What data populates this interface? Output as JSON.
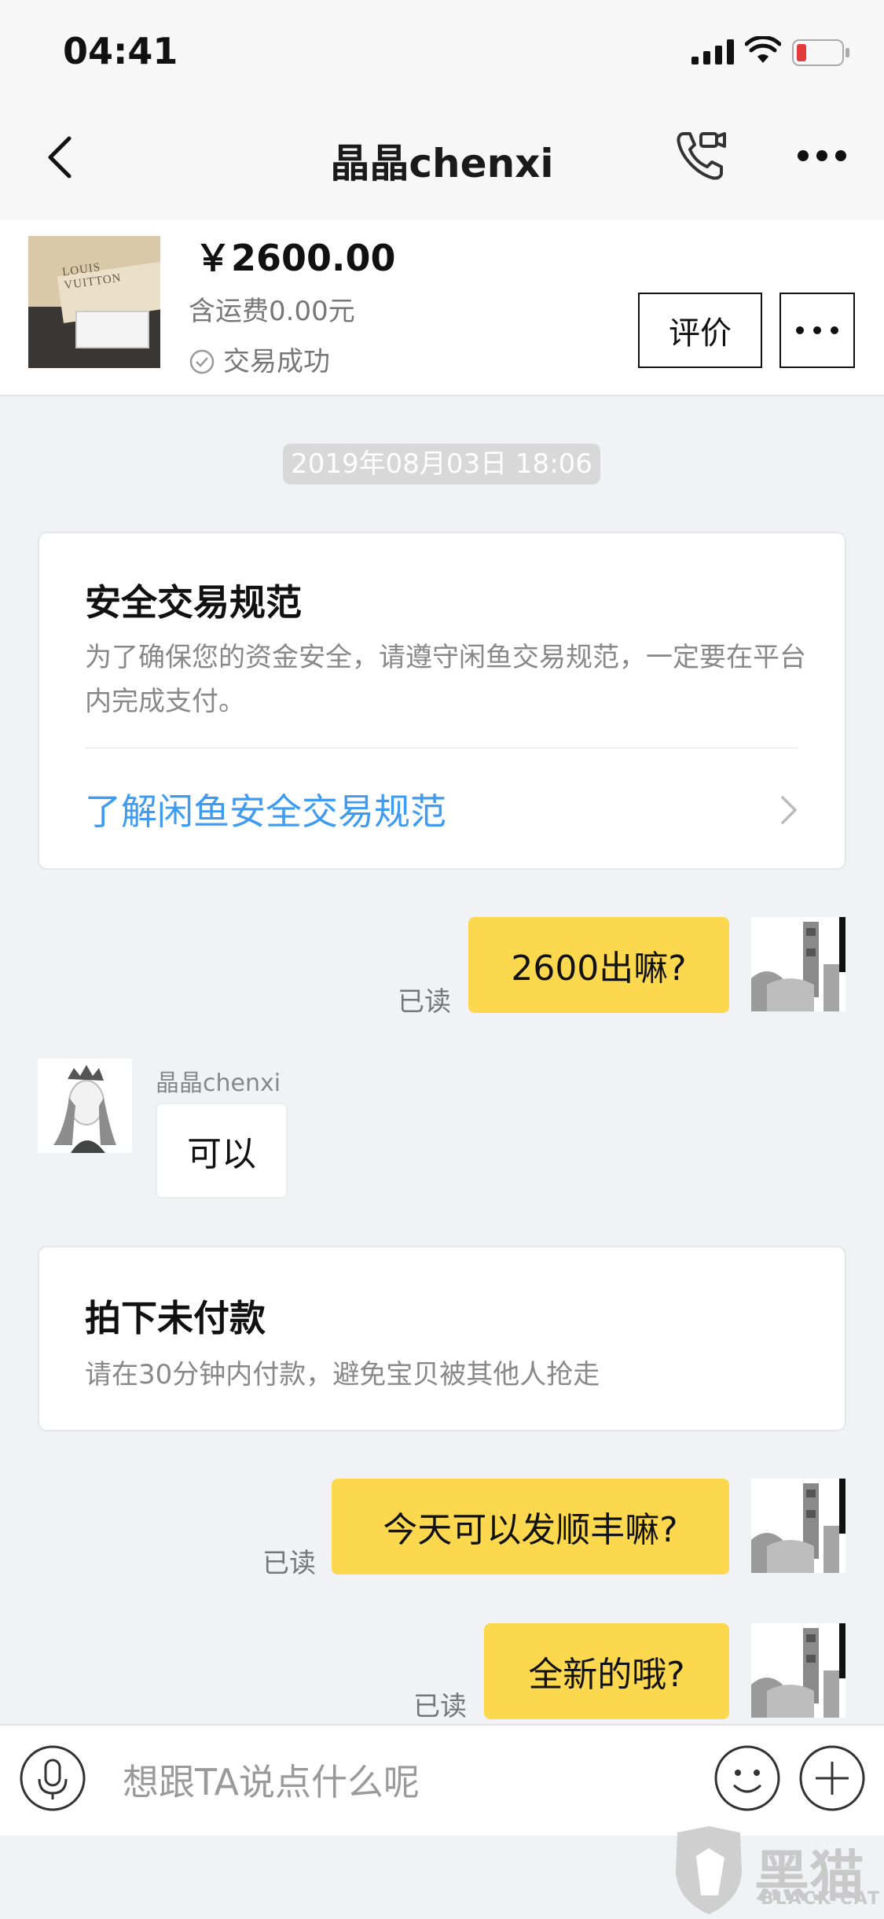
{
  "status_bar": {
    "time": "04:41"
  },
  "nav": {
    "title": "晶晶chenxi"
  },
  "product": {
    "thumb_text": "LOUIS VUITTON",
    "price": "￥2600.00",
    "shipping": "含运费0.00元",
    "trade_status": "交易成功",
    "review_label": "评价",
    "more_label": "•••"
  },
  "chat": {
    "timestamp": "2019年08月03日 18:06",
    "safety_card": {
      "title": "安全交易规范",
      "desc": "为了确保您的资金安全，请遵守闲鱼交易规范，一定要在平台内完成支付。",
      "link": "了解闲鱼安全交易规范"
    },
    "messages": [
      {
        "text": "2600出嘛?",
        "read": "已读"
      },
      {
        "sender": "晶晶chenxi",
        "text": "可以"
      },
      {
        "text": "今天可以发顺丰嘛?",
        "read": "已读"
      },
      {
        "text": "全新的哦?",
        "read": "已读"
      }
    ],
    "order_card": {
      "title": "拍下未付款",
      "desc": "请在30分钟内付款，避免宝贝被其他人抢走"
    }
  },
  "input": {
    "placeholder": "想跟TA说点什么呢"
  },
  "watermark": {
    "cn": "黑猫",
    "en": "BLACK CAT"
  },
  "colors": {
    "accent_yellow": "#fbd84d",
    "link_blue": "#3e9bf2",
    "background": "#f1f2f6"
  }
}
